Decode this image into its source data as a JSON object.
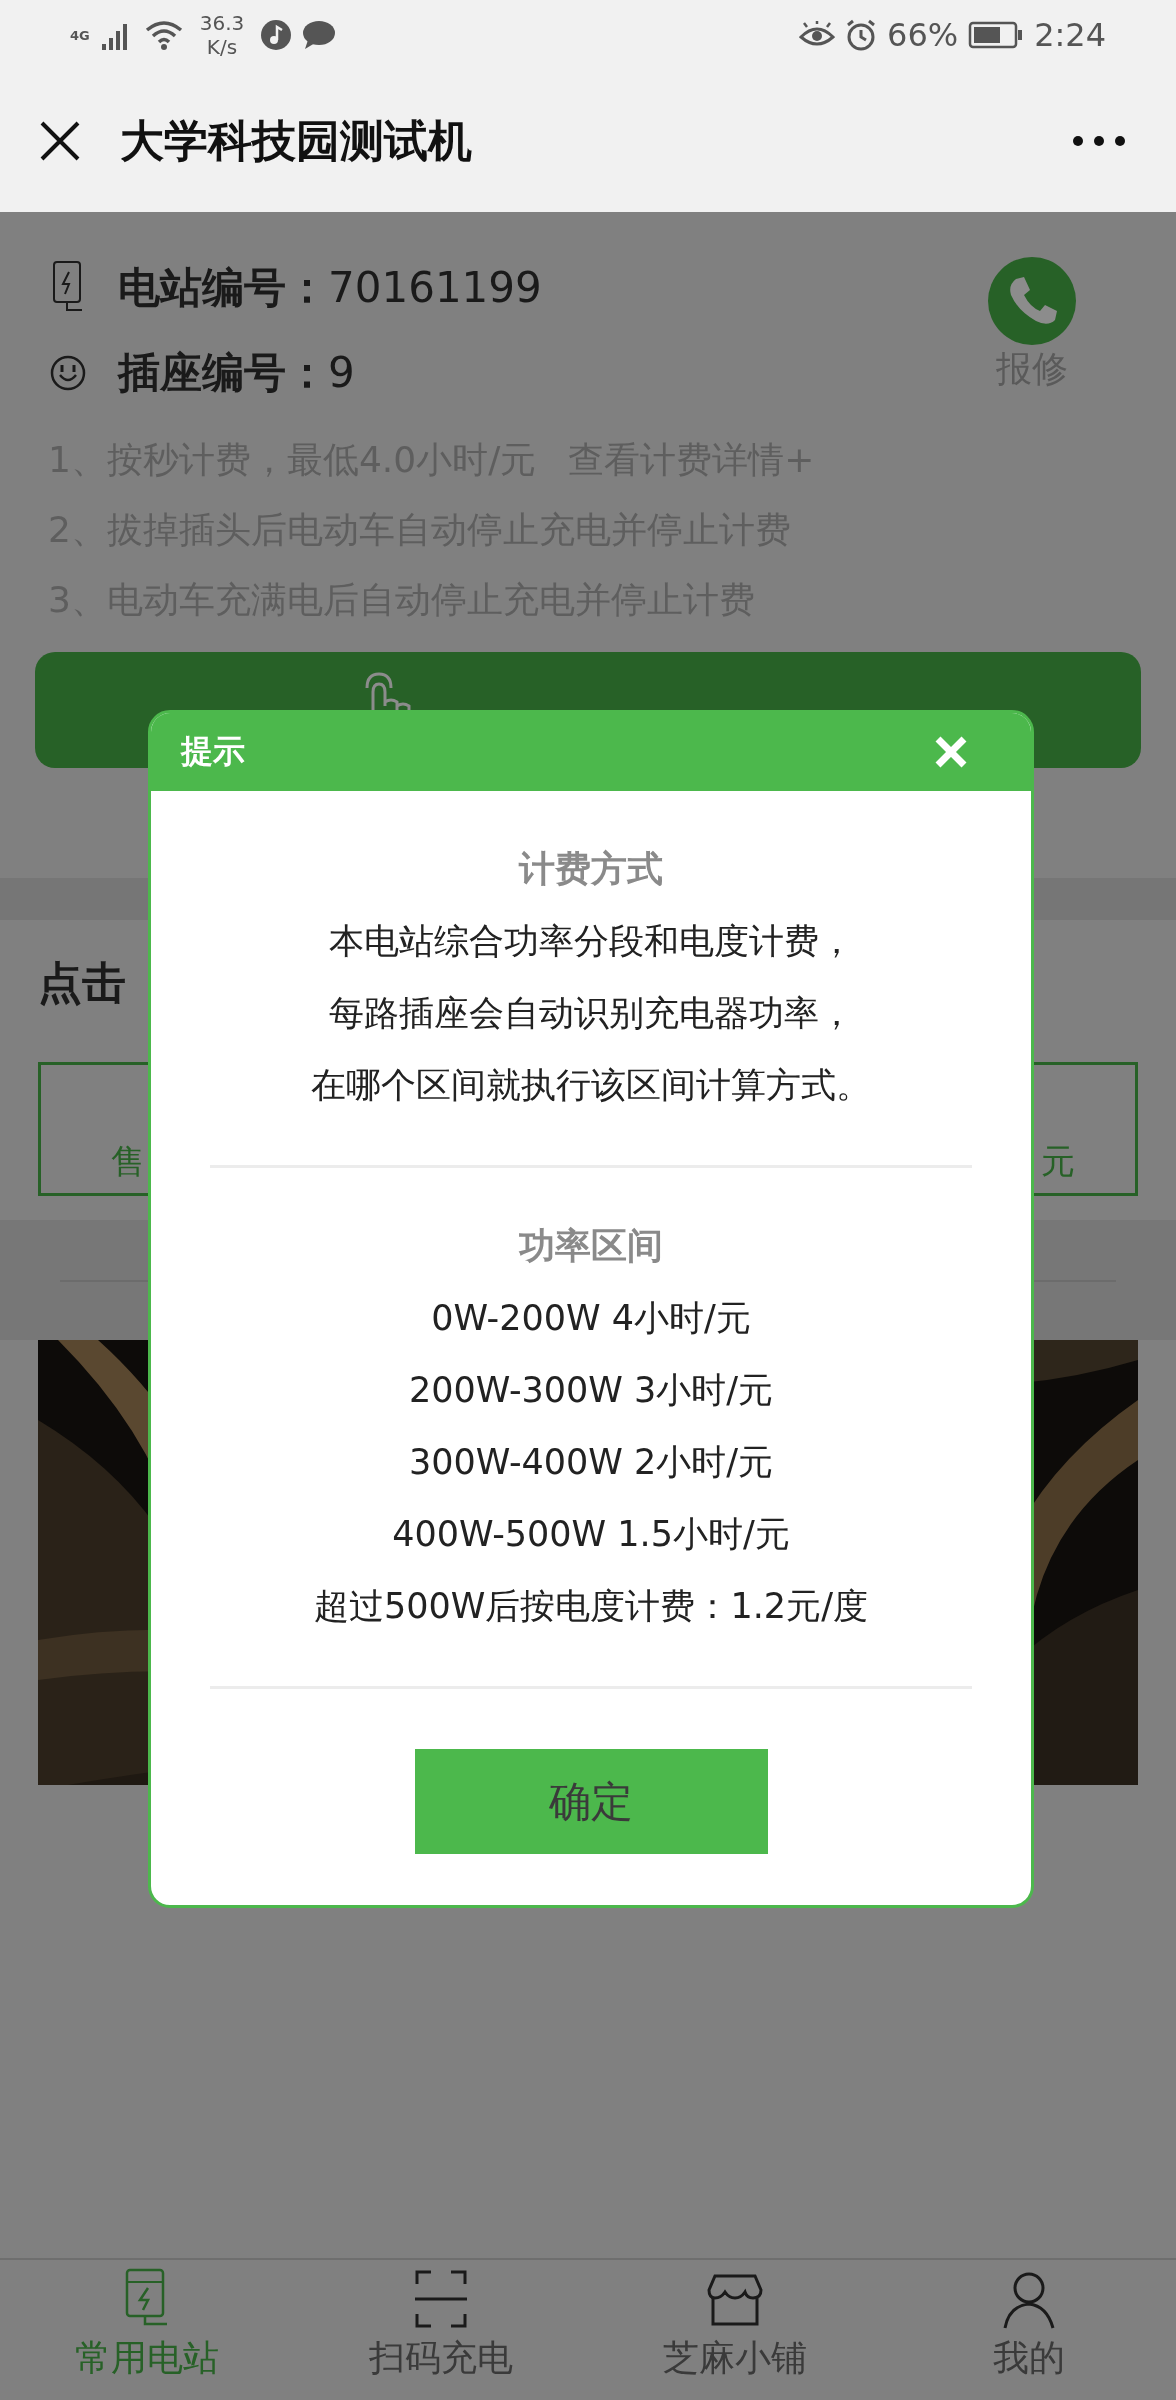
{
  "status_bar": {
    "network": "4G",
    "speed": "36.3",
    "speed_unit": "K/s",
    "battery": "66%",
    "time": "2:24"
  },
  "header": {
    "title": "大学科技园测试机"
  },
  "station": {
    "station_label": "电站编号：",
    "station_no": "70161199",
    "socket_label": "插座编号：",
    "socket_no": "9",
    "repair": "报修"
  },
  "rules": [
    {
      "text": "1、按秒计费，最低4.0小时/元",
      "link": "查看计费详情+"
    },
    {
      "text": "2、拔掉插头后电动车自动停止充电并停止计费"
    },
    {
      "text": "3、电动车充满电后自动停止充电并停止计费"
    }
  ],
  "section": {
    "title": "点击",
    "cards": [
      "售",
      "元"
    ]
  },
  "dialog": {
    "title": "提示",
    "sections": [
      {
        "heading": "计费方式",
        "lines": [
          "本电站综合功率分段和电度计费，",
          "每路插座会自动识别充电器功率，",
          "在哪个区间就执行该区间计算方式。"
        ]
      },
      {
        "heading": "功率区间",
        "lines": [
          "0W-200W 4小时/元",
          "200W-300W 3小时/元",
          "300W-400W 2小时/元",
          "400W-500W 1.5小时/元",
          "超过500W后按电度计费：1.2元/度"
        ]
      }
    ],
    "confirm": "确定"
  },
  "tabs": [
    {
      "label": "常用电站",
      "selected": true
    },
    {
      "label": "扫码充电",
      "selected": false
    },
    {
      "label": "芝麻小铺",
      "selected": false
    },
    {
      "label": "我的",
      "selected": false
    }
  ]
}
